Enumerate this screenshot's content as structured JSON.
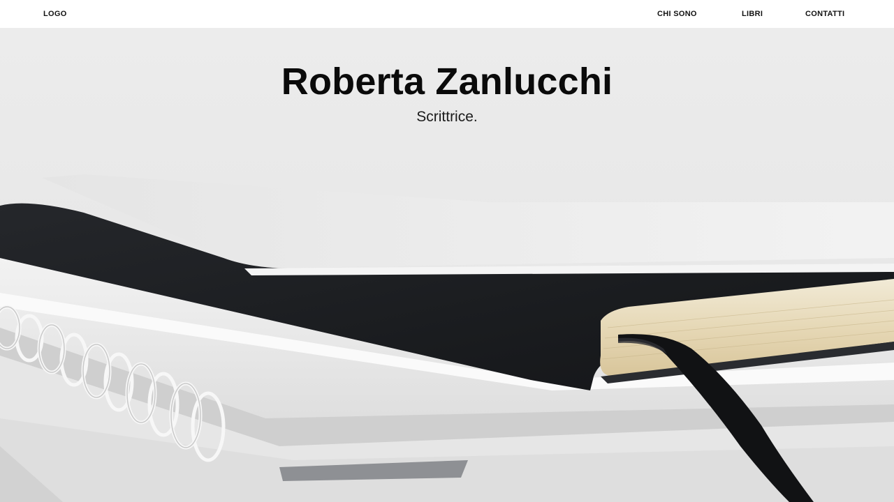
{
  "header": {
    "logo": "LOGO",
    "nav": [
      {
        "label": "CHI SONO"
      },
      {
        "label": "LIBRI"
      },
      {
        "label": "CONTATTI"
      }
    ]
  },
  "hero": {
    "title": "Roberta Zanlucchi",
    "subtitle": "Scrittrice.",
    "image_subject": "stack-of-notebooks-photo"
  },
  "colors": {
    "text": "#0a0a0a",
    "background": "#ffffff",
    "hero_bg": "#ebebeb",
    "notebook_cover": "#1c1e21",
    "page_edges": "#e8dcc0"
  }
}
